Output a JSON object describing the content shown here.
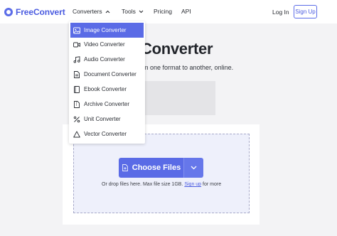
{
  "brand": {
    "name": "FreeConvert",
    "accent": "#5a6be6"
  },
  "nav": {
    "converters": "Converters",
    "tools": "Tools",
    "pricing": "Pricing",
    "api": "API",
    "login": "Log In",
    "signup": "Sign Up"
  },
  "hero": {
    "title": "Converter",
    "subtitle": "om one format to another, online."
  },
  "dropdown": {
    "items": [
      {
        "label": "Image Converter",
        "icon": "image-icon",
        "active": true
      },
      {
        "label": "Video Converter",
        "icon": "video-icon",
        "active": false
      },
      {
        "label": "Audio Converter",
        "icon": "music-note-icon",
        "active": false
      },
      {
        "label": "Document Converter",
        "icon": "document-icon",
        "active": false
      },
      {
        "label": "Ebook Converter",
        "icon": "book-icon",
        "active": false
      },
      {
        "label": "Archive Converter",
        "icon": "archive-icon",
        "active": false
      },
      {
        "label": "Unit Converter",
        "icon": "percent-icon",
        "active": false
      },
      {
        "label": "Vector Converter",
        "icon": "triangle-icon",
        "active": false
      }
    ]
  },
  "upload": {
    "button_label": "Choose Files",
    "drop_text_before": "Or drop files here. Max file size 1GB. ",
    "drop_link": "Sign up",
    "drop_text_after": " for more"
  }
}
